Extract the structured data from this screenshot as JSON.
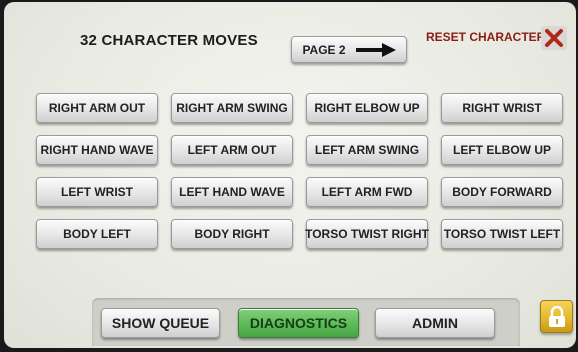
{
  "header": {
    "title": "32 CHARACTER MOVES",
    "page_button": "PAGE 2",
    "reset_label": "RESET CHARACTER"
  },
  "moves": [
    "RIGHT ARM OUT",
    "RIGHT ARM SWING",
    "RIGHT ELBOW UP",
    "RIGHT WRIST",
    "RIGHT HAND WAVE",
    "LEFT ARM OUT",
    "LEFT ARM SWING",
    "LEFT ELBOW UP",
    "LEFT WRIST",
    "LEFT HAND WAVE",
    "LEFT ARM FWD",
    "BODY FORWARD",
    "BODY LEFT",
    "BODY RIGHT",
    "TORSO TWIST RIGHT",
    "TORSO TWIST LEFT"
  ],
  "footer": {
    "show_queue": "SHOW QUEUE",
    "diagnostics": "DIAGNOSTICS",
    "admin": "ADMIN"
  },
  "colors": {
    "accent_green": "#5fbd5a",
    "reset_red": "#8b1e14",
    "lock_gold": "#e3b52a"
  },
  "icons": {
    "page_arrow": "arrow-right-icon",
    "reset": "close-x-icon",
    "lock": "lock-icon"
  }
}
